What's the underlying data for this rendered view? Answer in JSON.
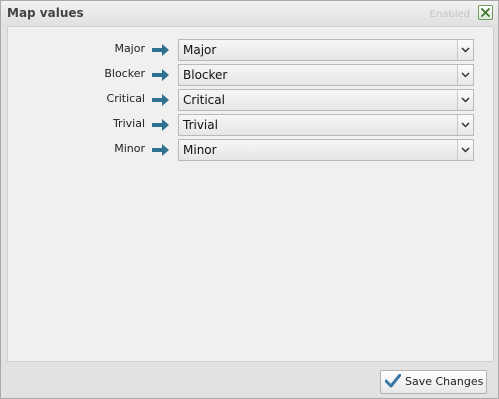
{
  "dialog": {
    "title": "Map values",
    "status": "Enabled",
    "close_icon": "close-icon"
  },
  "mappings": [
    {
      "source": "Major",
      "target": "Major"
    },
    {
      "source": "Blocker",
      "target": "Blocker"
    },
    {
      "source": "Critical",
      "target": "Critical"
    },
    {
      "source": "Trivial",
      "target": "Trivial"
    },
    {
      "source": "Minor",
      "target": "Minor"
    }
  ],
  "footer": {
    "save_label": "Save Changes",
    "save_icon": "checkmark-icon"
  },
  "colors": {
    "arrow": "#2f6f8f",
    "checkmark": "#3a78a6",
    "close_x": "#3d7a2e"
  }
}
